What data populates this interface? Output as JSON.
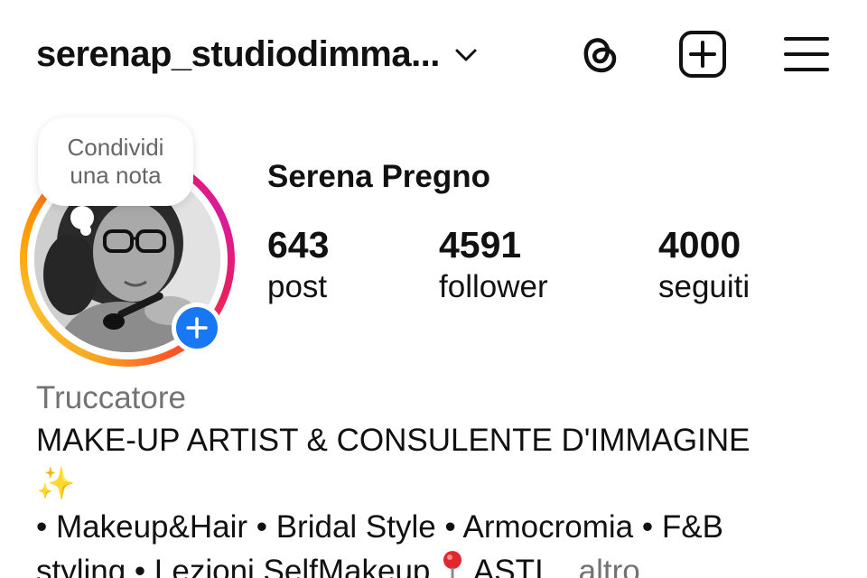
{
  "header": {
    "username": "serenap_studiodimma...",
    "icons": [
      "chevron-down-icon",
      "threads-icon",
      "create-post-icon",
      "menu-icon"
    ]
  },
  "note": {
    "line1": "Condividi",
    "line2": "una nota"
  },
  "profile": {
    "full_name": "Serena Pregno",
    "stats": {
      "posts_count": "643",
      "posts_label": "post",
      "followers_count": "4591",
      "followers_label": "follower",
      "following_count": "4000",
      "following_label": "seguiti"
    }
  },
  "bio": {
    "category": "Truccatore",
    "line1": "MAKE-UP ARTIST & CONSULENTE D'IMMAGINE",
    "line2_emoji": "✨",
    "line3": "• Makeup&Hair • Bridal Style • Armocromia • F&B",
    "line4_start": "styling • Lezioni SelfMakeup ",
    "line4_end": " ASTI...",
    "more_label": " altro"
  },
  "colors": {
    "accent_blue": "#1877f2",
    "muted_text": "#737373",
    "text": "#111111"
  }
}
